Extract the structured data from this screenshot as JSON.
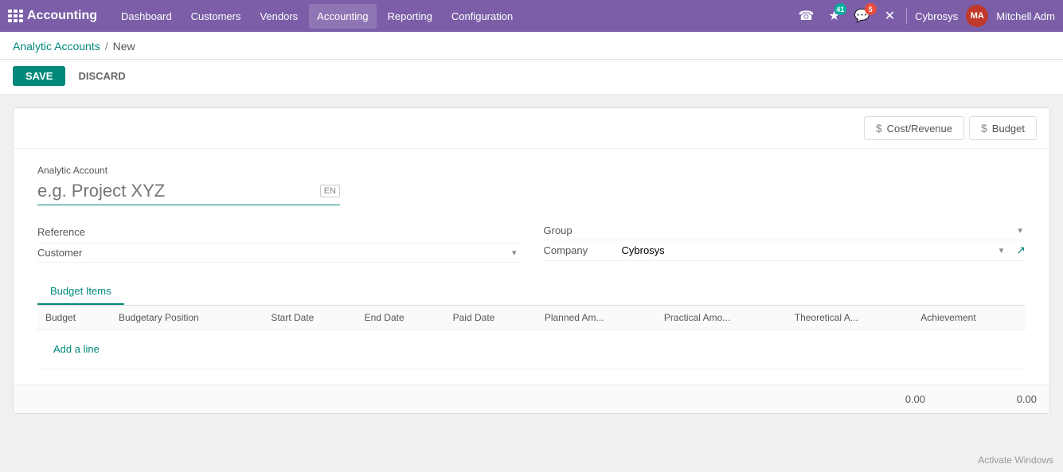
{
  "navbar": {
    "brand": "Accounting",
    "links": [
      "Dashboard",
      "Customers",
      "Vendors",
      "Accounting",
      "Reporting",
      "Configuration"
    ],
    "active_link": "Accounting",
    "badge_activity": "41",
    "badge_chat": "5",
    "company": "Cybrosys",
    "user": "Mitchell Adm"
  },
  "breadcrumb": {
    "parent": "Analytic Accounts",
    "separator": "/",
    "current": "New"
  },
  "actions": {
    "save": "SAVE",
    "discard": "DISCARD"
  },
  "stat_buttons": {
    "cost_revenue": "Cost/Revenue",
    "budget": "Budget"
  },
  "form": {
    "analytic_account_label": "Analytic Account",
    "name_placeholder": "e.g. Project XYZ",
    "lang": "EN",
    "reference_label": "Reference",
    "reference_value": "",
    "customer_label": "Customer",
    "customer_value": "",
    "group_label": "Group",
    "group_value": "",
    "company_label": "Company",
    "company_value": "Cybrosys"
  },
  "tabs": [
    {
      "label": "Budget Items",
      "active": true
    }
  ],
  "table": {
    "columns": [
      "Budget",
      "Budgetary Position",
      "Start Date",
      "End Date",
      "Paid Date",
      "Planned Am...",
      "Practical Amo...",
      "Theoretical A...",
      "Achievement"
    ],
    "rows": [],
    "add_line": "Add a line"
  },
  "footer": {
    "practical_total": "0.00",
    "theoretical_total": "0.00"
  },
  "watermark": "Activate Windows"
}
